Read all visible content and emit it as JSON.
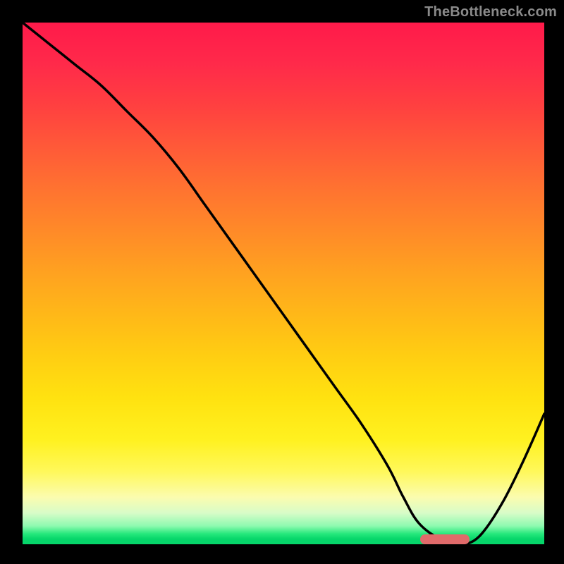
{
  "watermark": "TheBottleneck.com",
  "colors": {
    "background": "#000000",
    "curve": "#000000",
    "marker": "#e06a6a",
    "gradient_top": "#ff1a4a",
    "gradient_bottom": "#06d66a"
  },
  "chart_data": {
    "type": "line",
    "title": "",
    "xlabel": "",
    "ylabel": "",
    "x_range": [
      0,
      100
    ],
    "y_range": [
      0,
      100
    ],
    "series": [
      {
        "name": "bottleneck-curve",
        "x": [
          0,
          5,
          10,
          15,
          20,
          25,
          30,
          35,
          40,
          45,
          50,
          55,
          60,
          65,
          70,
          73,
          76,
          80,
          83,
          85,
          88,
          92,
          96,
          100
        ],
        "y": [
          100,
          96,
          92,
          88,
          83,
          78,
          72,
          65,
          58,
          51,
          44,
          37,
          30,
          23,
          15,
          9,
          4,
          1,
          0,
          0,
          2,
          8,
          16,
          25
        ]
      }
    ],
    "annotations": [
      {
        "name": "optimal-marker",
        "shape": "pill",
        "x": 81,
        "y": 1,
        "color": "#e06a6a"
      }
    ],
    "background_gradient": {
      "direction": "vertical",
      "stops": [
        {
          "pos": 0.0,
          "color": "#ff1a4a"
        },
        {
          "pos": 0.5,
          "color": "#ffa220"
        },
        {
          "pos": 0.8,
          "color": "#fff120"
        },
        {
          "pos": 0.95,
          "color": "#8dfab0"
        },
        {
          "pos": 1.0,
          "color": "#06d66a"
        }
      ]
    }
  }
}
